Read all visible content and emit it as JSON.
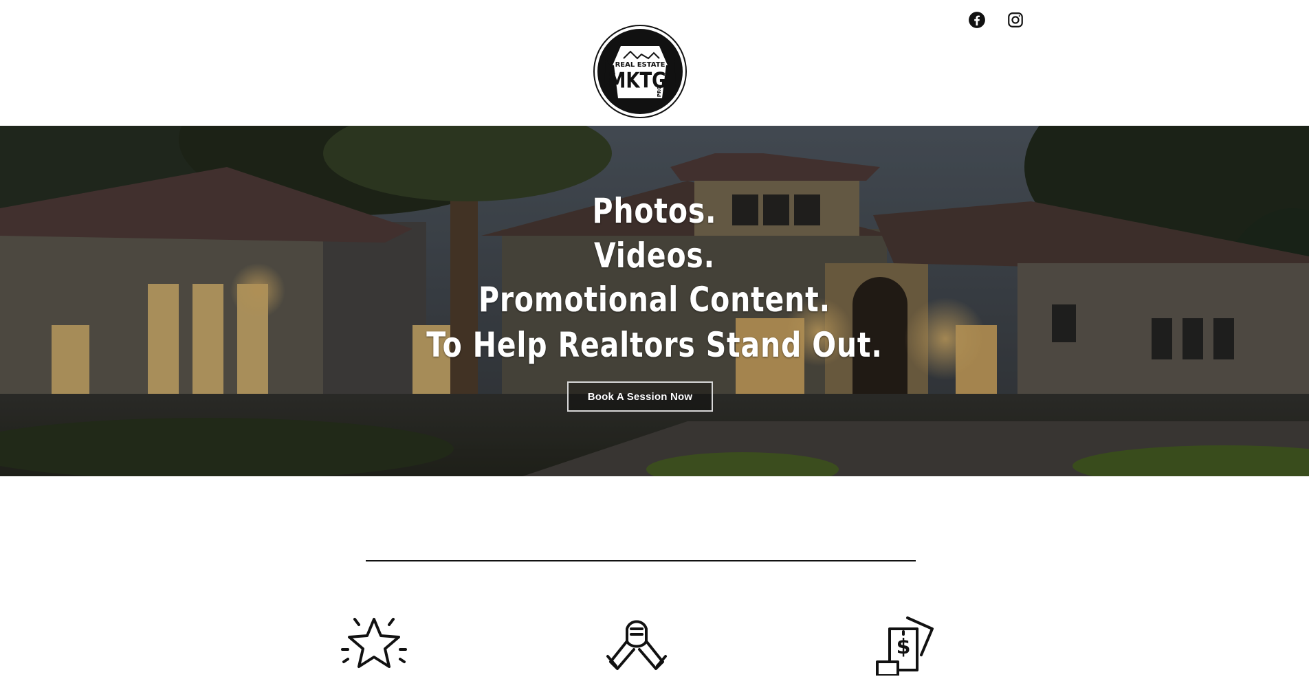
{
  "header": {
    "logo": {
      "top_text": "REAL ESTATE",
      "main_text": "MKTG",
      "sub_text": "PRO"
    },
    "social": [
      {
        "name": "facebook-icon"
      },
      {
        "name": "instagram-icon"
      }
    ]
  },
  "hero": {
    "lines": [
      "Photos.",
      "Videos.",
      "Promotional Content.",
      "To Help Realtors Stand Out."
    ],
    "cta_label": "Book A Session Now"
  },
  "features": {
    "icons": [
      "star-icon",
      "handshake-icon",
      "money-icon"
    ]
  },
  "colors": {
    "text_dark": "#111111",
    "hero_text": "#ffffff",
    "accent_warm": "#e9b866"
  }
}
